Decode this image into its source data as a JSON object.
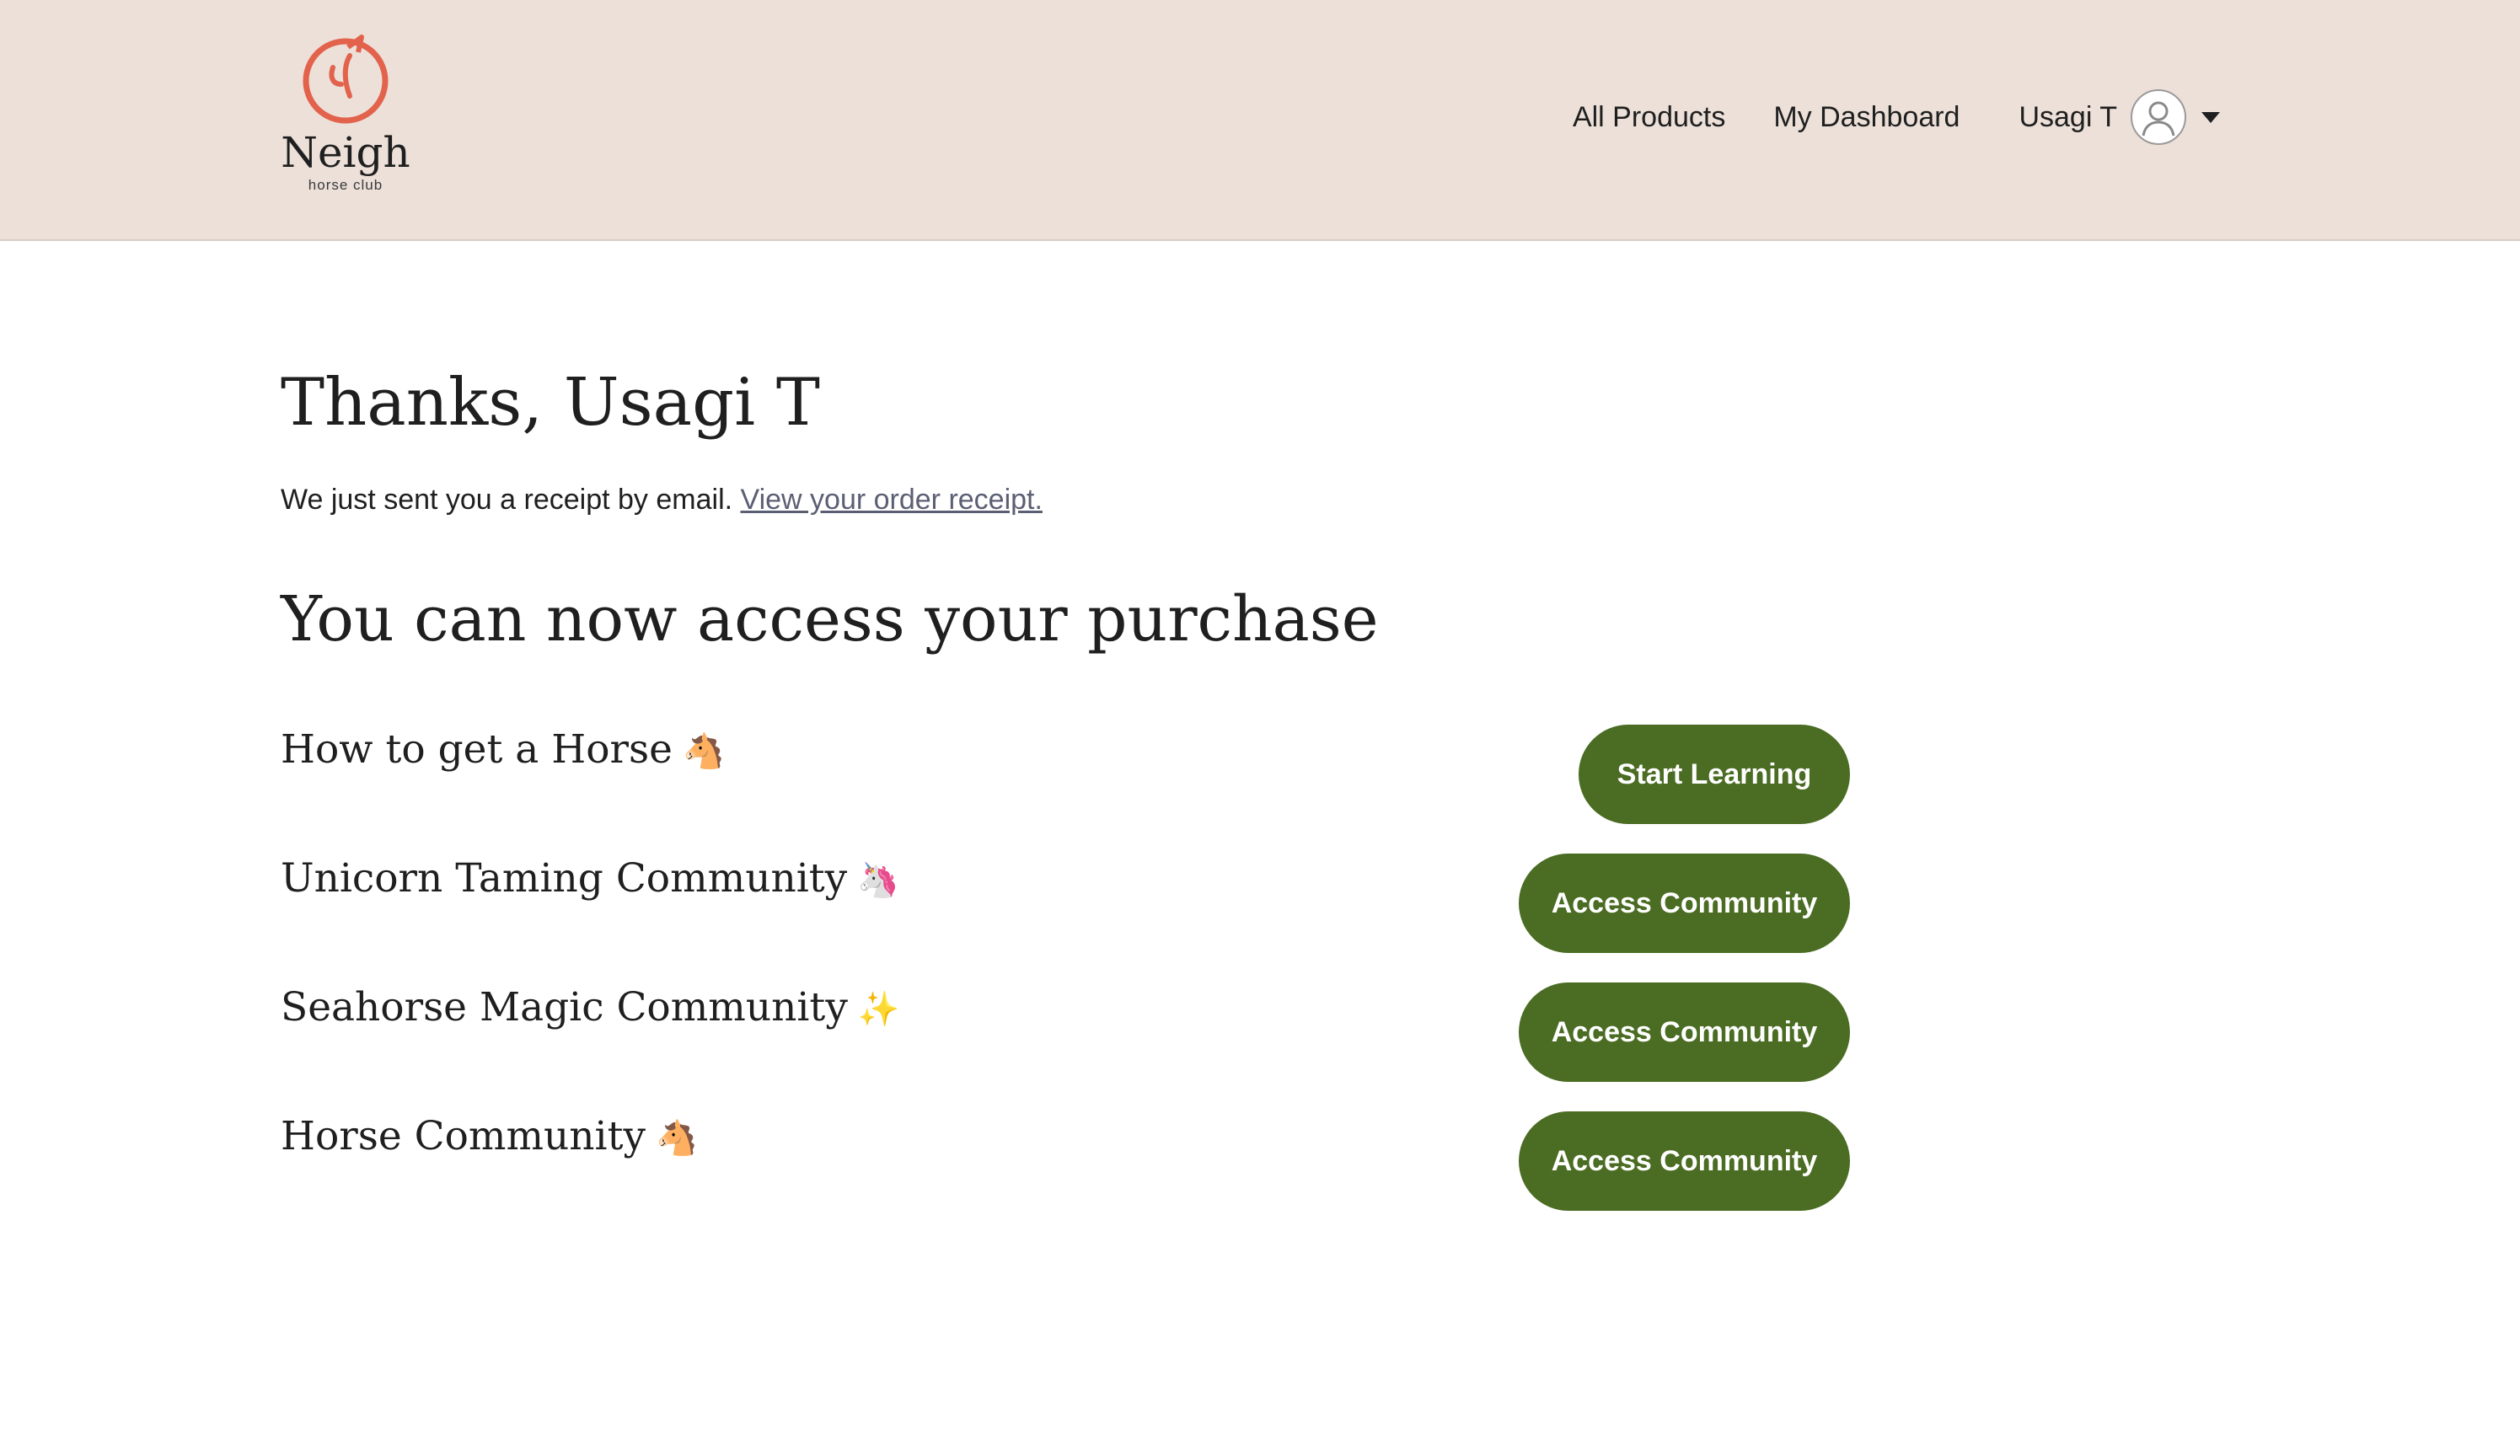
{
  "brand": {
    "name": "Neigh",
    "tagline": "horse club",
    "accent": "#e2624c"
  },
  "nav": {
    "all_products": "All Products",
    "dashboard": "My Dashboard",
    "user_name": "Usagi T"
  },
  "main": {
    "thanks_title": "Thanks, Usagi T",
    "receipt_text": "We just sent you a receipt by email. ",
    "receipt_link": "View your order receipt.",
    "access_title": "You can now access your purchase"
  },
  "products": [
    {
      "name": "How to get a Horse",
      "emoji": "🐴",
      "button": "Start Learning"
    },
    {
      "name": "Unicorn Taming Community",
      "emoji": "🦄",
      "button": "Access Community"
    },
    {
      "name": "Seahorse Magic Community",
      "emoji": "✨",
      "button": "Access Community"
    },
    {
      "name": "Horse Community",
      "emoji": "🐴",
      "button": "Access Community"
    }
  ],
  "colors": {
    "header_bg": "#ece0d9",
    "button_bg": "#4b6c23",
    "link": "#5b5f73"
  }
}
